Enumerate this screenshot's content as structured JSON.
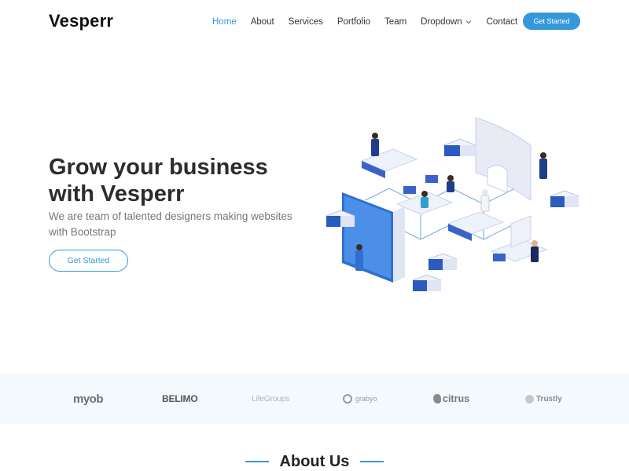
{
  "brand": {
    "name": "Vesperr"
  },
  "nav": {
    "items": [
      {
        "label": "Home",
        "active": true
      },
      {
        "label": "About"
      },
      {
        "label": "Services"
      },
      {
        "label": "Portfolio"
      },
      {
        "label": "Team"
      },
      {
        "label": "Dropdown",
        "has_dropdown": true
      },
      {
        "label": "Contact"
      }
    ],
    "cta_label": "Get Started"
  },
  "hero": {
    "title_line1": "Grow your business",
    "title_line2": "with Vesperr",
    "subtitle": "We are team of talented designers making websites with Bootstrap",
    "button_label": "Get Started",
    "illustration_icon": "isometric-office-illustration"
  },
  "clients": {
    "logos": [
      "myob",
      "BELIMO",
      "LifeGroups",
      "grabyo",
      "citrus",
      "Trustly"
    ]
  },
  "about": {
    "title": "About Us"
  },
  "colors": {
    "accent": "#3498db",
    "clients_bg": "#f3f9fd",
    "heading": "#2c2c2c",
    "muted": "#777777"
  }
}
